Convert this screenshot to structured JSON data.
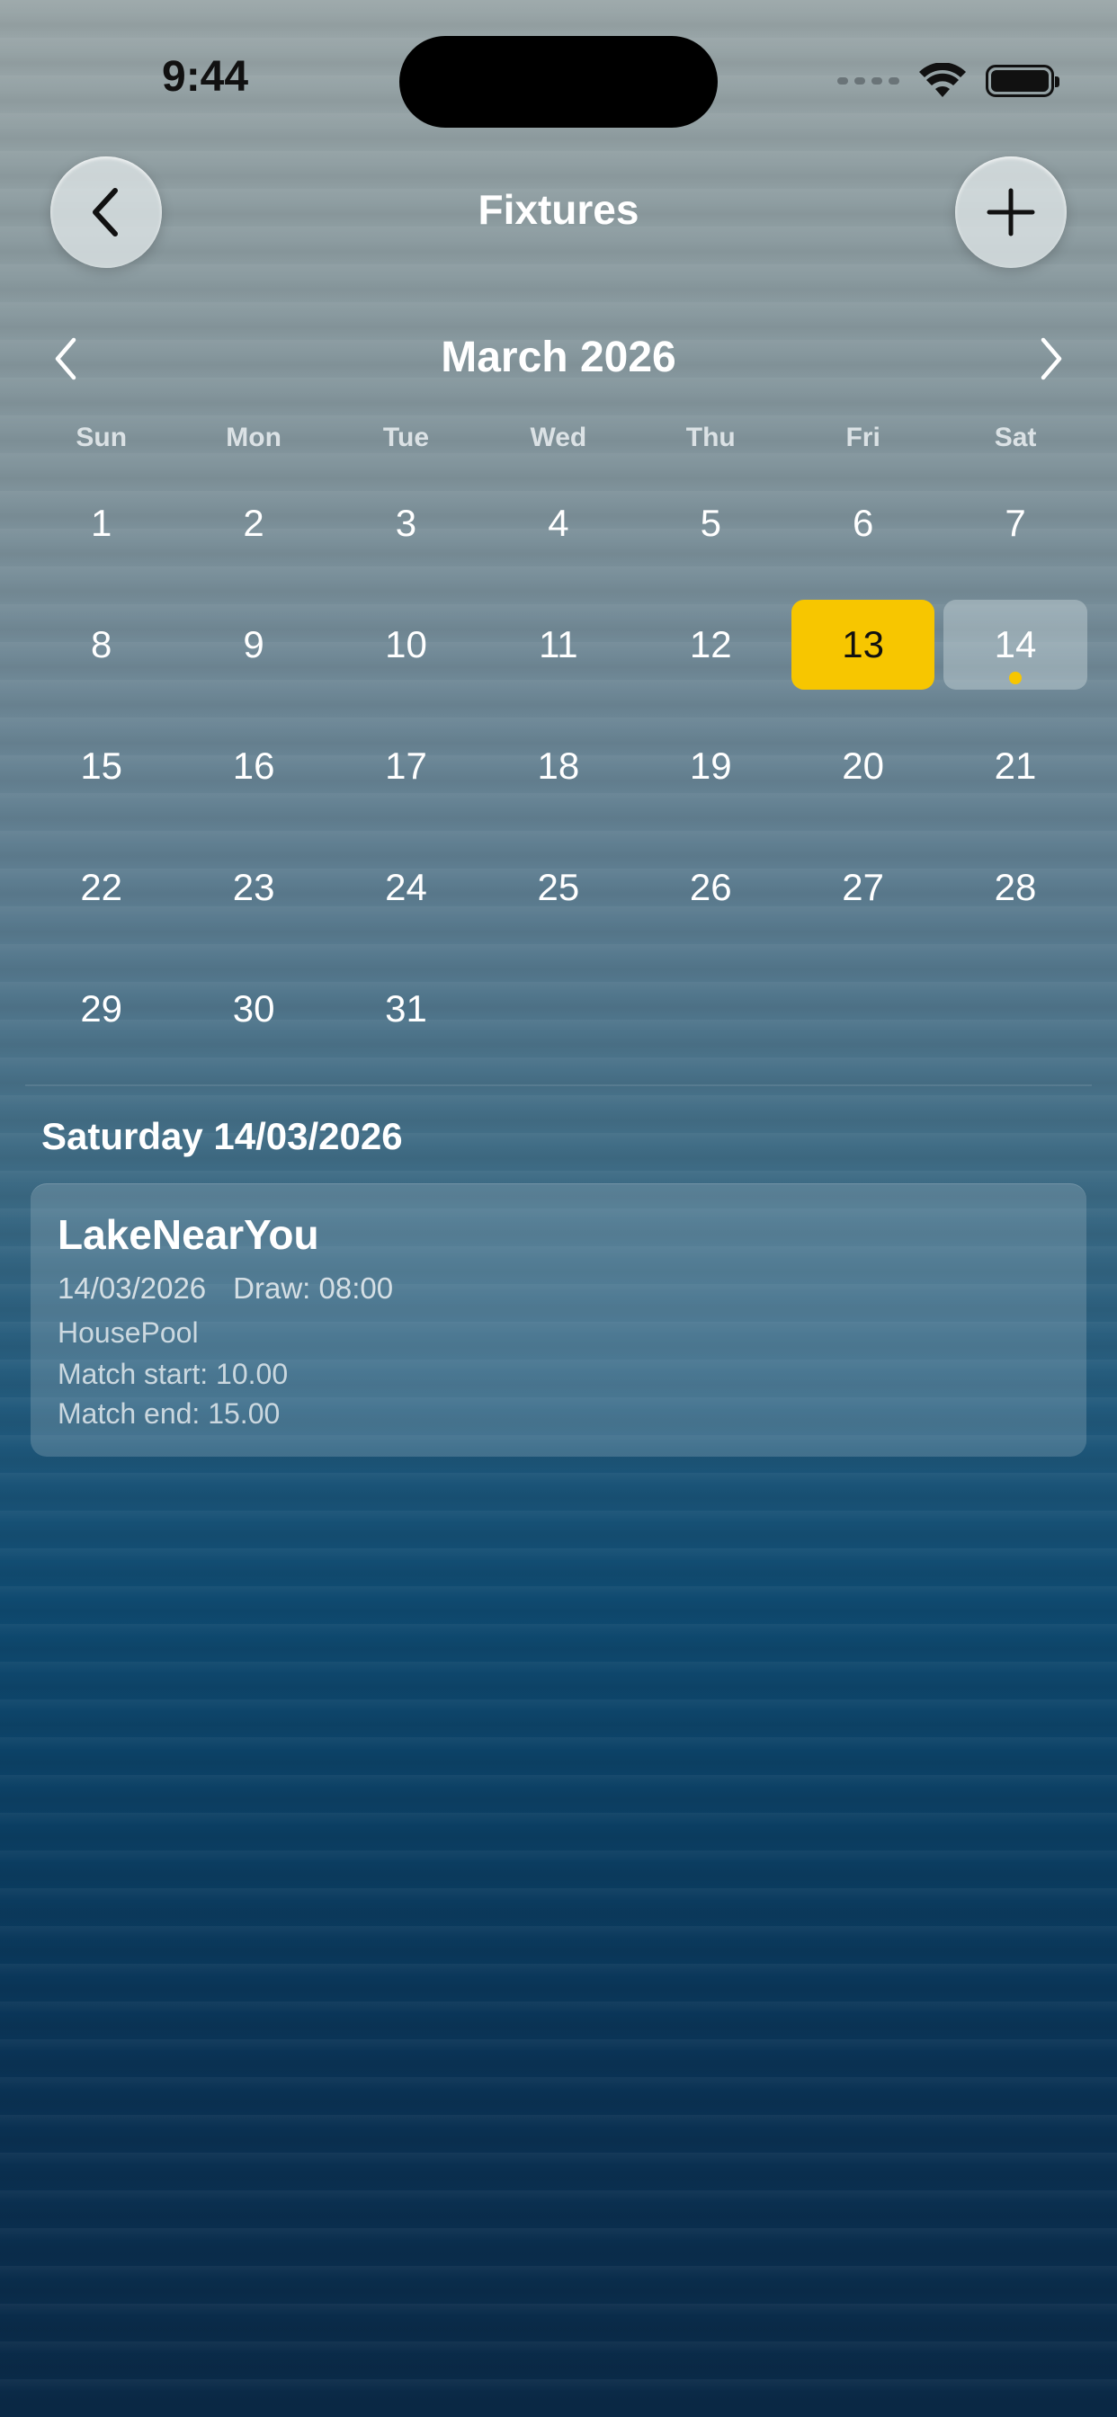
{
  "status_bar": {
    "time": "9:44"
  },
  "header": {
    "title": "Fixtures",
    "back_icon": "chevron-left-icon",
    "add_icon": "plus-icon"
  },
  "calendar": {
    "month_label": "March 2026",
    "weekdays": [
      "Sun",
      "Mon",
      "Tue",
      "Wed",
      "Thu",
      "Fri",
      "Sat"
    ],
    "weeks": [
      [
        1,
        2,
        3,
        4,
        5,
        6,
        7
      ],
      [
        8,
        9,
        10,
        11,
        12,
        13,
        14
      ],
      [
        15,
        16,
        17,
        18,
        19,
        20,
        21
      ],
      [
        22,
        23,
        24,
        25,
        26,
        27,
        28
      ],
      [
        29,
        30,
        31,
        null,
        null,
        null,
        null
      ]
    ],
    "today": 13,
    "selected": 14,
    "event_days": [
      14
    ],
    "today_color": "#f7c600"
  },
  "selected_date_label": "Saturday 14/03/2026",
  "fixture": {
    "name": "LakeNearYou",
    "date": "14/03/2026",
    "draw": "Draw: 08:00",
    "pool": "HousePool",
    "match_start": "Match start: 10.00",
    "match_end": "Match end: 15.00"
  }
}
